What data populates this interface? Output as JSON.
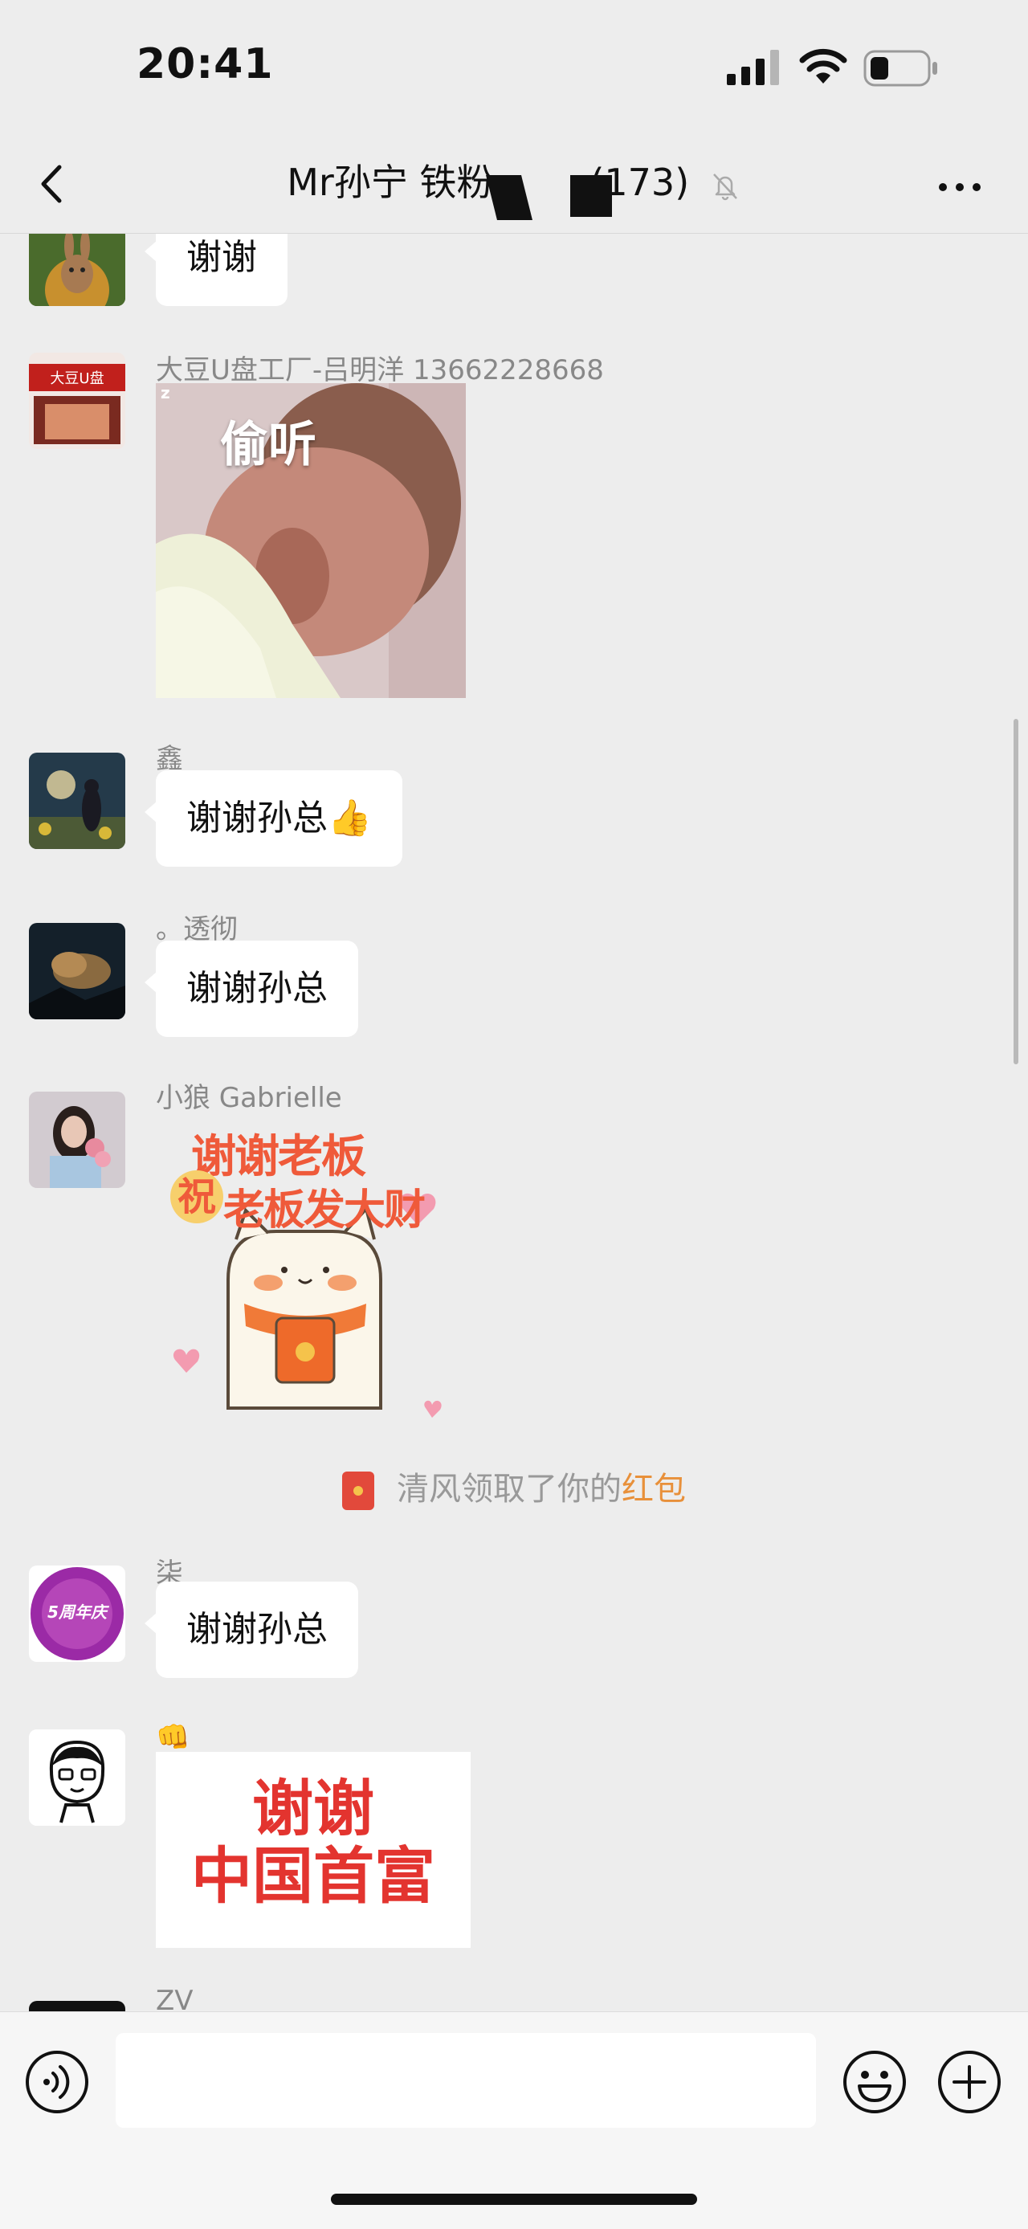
{
  "status_bar": {
    "time": "20:41"
  },
  "header": {
    "title_prefix": "Mr孙宁 铁粉",
    "member_count": "(173)"
  },
  "messages": [
    {
      "sender": "",
      "text": "谢谢"
    },
    {
      "sender": "大豆U盘工厂-吕明洋 13662228668",
      "sticker_text": "偷听",
      "sticker_mark": "z"
    },
    {
      "sender": "鑫",
      "text": "谢谢孙总",
      "emoji": "👍"
    },
    {
      "sender": "。透彻",
      "text": "谢谢孙总"
    },
    {
      "sender": "小狼 Gabrielle",
      "sticker_line1": "谢谢老板",
      "sticker_line2_a": "祝",
      "sticker_line2_b": "老板发大财"
    },
    {
      "sender": "柒",
      "text": "谢谢孙总",
      "avatar_badge": "5周年庆"
    },
    {
      "sender": "👊",
      "sticker_line1": "谢谢",
      "sticker_line2": "中国首富"
    },
    {
      "sender": "ZV"
    }
  ],
  "system_notice": {
    "text": "清风领取了你的",
    "link": "红包"
  },
  "colors": {
    "background": "#ededed",
    "bubble": "#ffffff",
    "sender": "#888888",
    "system_link": "#e8903a",
    "red_packet": "#e2493b",
    "sticker_red": "#e3342f"
  },
  "icons": [
    "back-icon",
    "mute-icon",
    "more-icon",
    "voice-icon",
    "emoji-icon",
    "plus-icon"
  ]
}
